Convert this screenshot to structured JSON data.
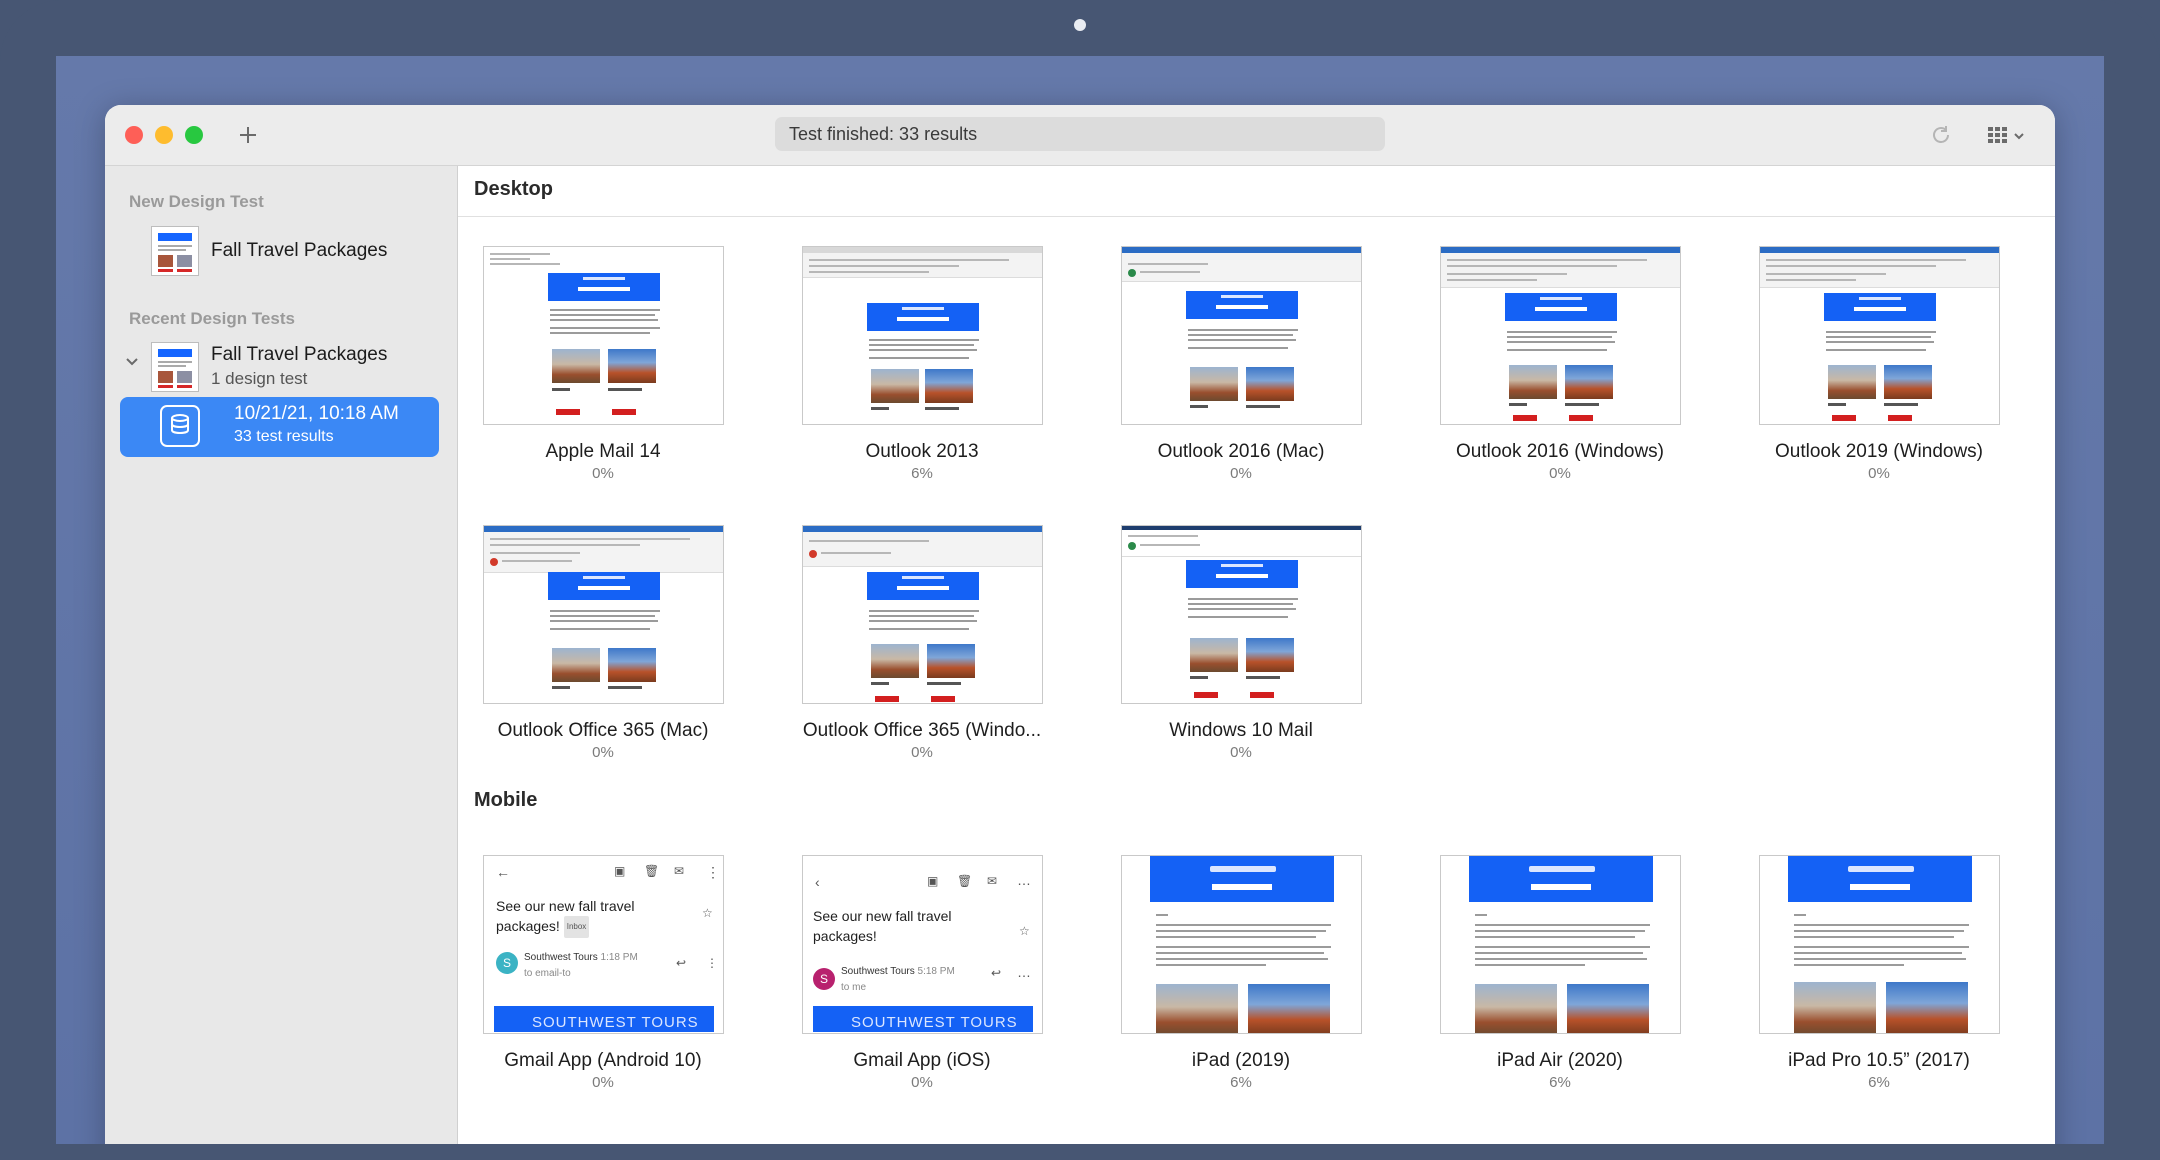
{
  "window": {
    "status_text": "Test finished: 33 results"
  },
  "sidebar": {
    "new_heading": "New Design Test",
    "new_item_label": "Fall Travel Packages",
    "recent_heading": "Recent Design Tests",
    "recent_item_label": "Fall Travel Packages",
    "recent_item_sub": "1 design test",
    "selected_title": "10/21/21, 10:18 AM",
    "selected_sub": "33 test results"
  },
  "sections": {
    "desktop_label": "Desktop",
    "mobile_label": "Mobile"
  },
  "desktop_results": [
    {
      "name": "Apple Mail 14",
      "pct": "0%"
    },
    {
      "name": "Outlook 2013",
      "pct": "6%"
    },
    {
      "name": "Outlook 2016 (Mac)",
      "pct": "0%"
    },
    {
      "name": "Outlook 2016 (Windows)",
      "pct": "0%"
    },
    {
      "name": "Outlook 2019 (Windows)",
      "pct": "0%"
    },
    {
      "name": "Outlook Office 365 (Mac)",
      "pct": "0%"
    },
    {
      "name": "Outlook Office 365 (Windo...",
      "pct": "0%"
    },
    {
      "name": "Windows 10 Mail",
      "pct": "0%"
    }
  ],
  "mobile_results": [
    {
      "name": "Gmail App (Android 10)",
      "pct": "0%"
    },
    {
      "name": "Gmail App (iOS)",
      "pct": "0%"
    },
    {
      "name": "iPad (2019)",
      "pct": "6%"
    },
    {
      "name": "iPad Air (2020)",
      "pct": "6%"
    },
    {
      "name": "iPad Pro 10.5” (2017)",
      "pct": "6%"
    }
  ],
  "gmail_android": {
    "subject": "See our new fall travel packages!",
    "tag": "Inbox",
    "sender": "Southwest Tours",
    "time": "1:18 PM",
    "to": "to email-to",
    "avatar": "S",
    "banner": "SOUTHWEST TOURS"
  },
  "gmail_ios": {
    "subject": "See our new fall travel packages!",
    "sender": "Southwest Tours",
    "time": "5:18 PM",
    "to": "to me",
    "avatar": "S",
    "banner": "SOUTHWEST TOURS"
  },
  "colors": {
    "accent": "#3b88f5",
    "email_header_blue": "#1461f5",
    "book_button_red": "#d31f1f"
  }
}
